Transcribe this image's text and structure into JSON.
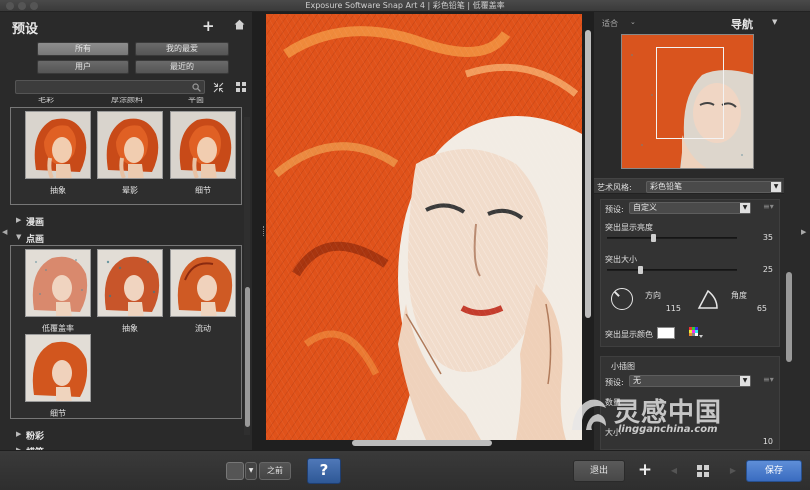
{
  "window": {
    "title": "Exposure Software Snap Art 4 | 彩色铅笔 | 低覆盖率"
  },
  "left_panel": {
    "title": "预设",
    "filters": [
      {
        "label": "所有",
        "active": true
      },
      {
        "label": "我的最爱",
        "active": false
      },
      {
        "label": "用户",
        "active": false
      },
      {
        "label": "最近的",
        "active": false
      }
    ],
    "search": {
      "placeholder": "",
      "value": ""
    },
    "cut_categories": [
      "毛彩",
      "厚涂颜料",
      "平面"
    ],
    "group1": [
      {
        "label": "抽象"
      },
      {
        "label": "晕影"
      },
      {
        "label": "细节"
      }
    ],
    "categories": [
      {
        "label": "漫画",
        "expanded": false
      },
      {
        "label": "点画",
        "expanded": true
      },
      {
        "label": "粉彩",
        "expanded": false
      },
      {
        "label": "蜡笔",
        "expanded": false
      }
    ],
    "group2": [
      {
        "label": "低覆盖率"
      },
      {
        "label": "抽象"
      },
      {
        "label": "流动"
      },
      {
        "label": "细节"
      }
    ]
  },
  "navigator": {
    "fit_label": "适合",
    "title": "导航"
  },
  "settings": {
    "art_style_label": "艺术风格:",
    "art_style_value": "彩色铅笔",
    "preset_label": "预设:",
    "preset_value": "自定义",
    "sliders": [
      {
        "label": "突出显示亮度",
        "value": 35,
        "fraction": 0.35
      },
      {
        "label": "突出大小",
        "value": 25,
        "fraction": 0.25
      }
    ],
    "direction": {
      "label": "方向",
      "value": 115
    },
    "angle": {
      "label": "角度",
      "value": 65
    },
    "highlight_color_label": "突出显示颜色",
    "highlight_color": "#ffffff"
  },
  "small_illustration": {
    "title": "小插图",
    "preset_label": "预设:",
    "preset_value": "无",
    "amount_label": "数量",
    "size_label": "大小",
    "size_value": 10
  },
  "bottom_bar": {
    "before_label": "之前",
    "help_label": "?",
    "exit_label": "退出",
    "add_label": "+",
    "save_label": "保存"
  },
  "watermark": {
    "text": "灵感中国",
    "url": "lingganchina.com"
  },
  "colors": {
    "accent_blue": "#3a6cc0",
    "hair_orange": "#e0521a",
    "background": "#2b2b2b"
  }
}
